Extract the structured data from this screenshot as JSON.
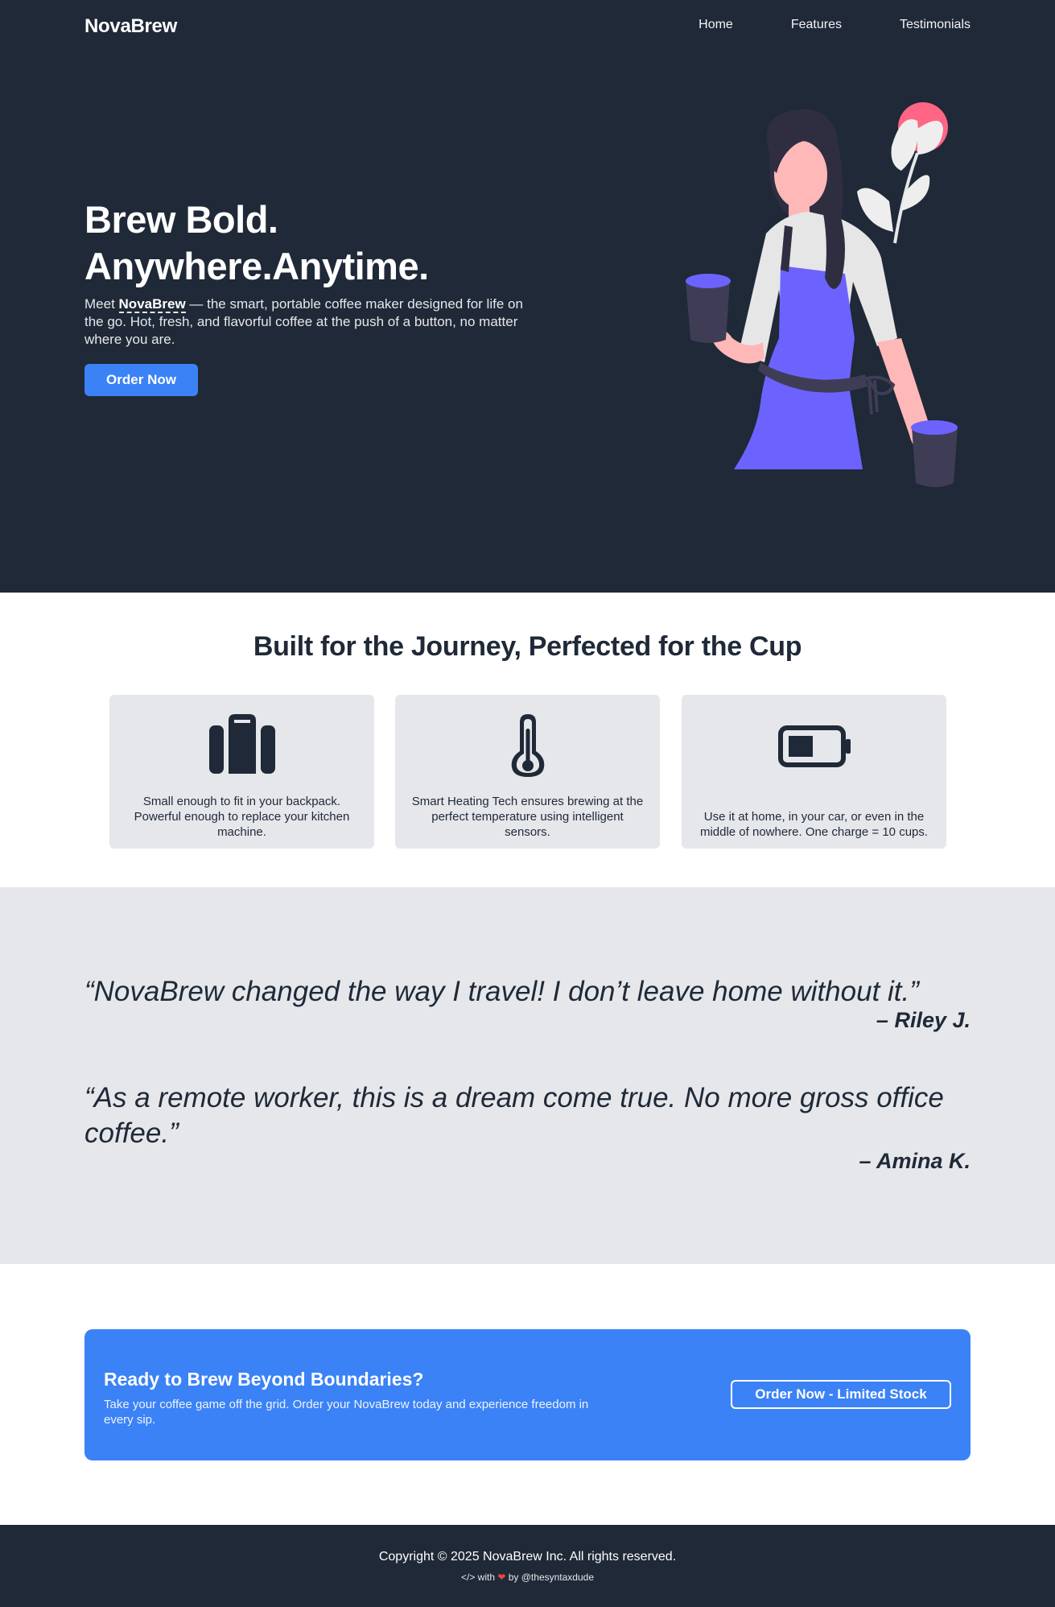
{
  "nav": {
    "brand": "NovaBrew",
    "links": [
      "Home",
      "Features",
      "Testimonials"
    ]
  },
  "hero": {
    "title_line1": "Brew Bold.",
    "title_line2": "Anywhere.Anytime.",
    "desc_prefix": "Meet ",
    "desc_brand": "NovaBrew",
    "desc_suffix": " — the smart, portable coffee maker designed for life on the go. Hot, fresh, and flavorful coffee at the push of a button, no matter where you are.",
    "cta_label": "Order Now"
  },
  "features": {
    "title": "Built for the Journey, Perfected for the Cup",
    "cards": [
      {
        "icon": "suitcase-icon",
        "text": "Small enough to fit in your backpack. Powerful enough to replace your kitchen machine."
      },
      {
        "icon": "thermometer-icon",
        "text": "Smart Heating Tech ensures brewing at the perfect temperature using intelligent sensors."
      },
      {
        "icon": "battery-icon",
        "text": "Use it at home, in your car, or even in the middle of nowhere. One charge = 10 cups."
      }
    ]
  },
  "testimonials": [
    {
      "quote": "“NovaBrew changed the way I travel! I don’t leave home without it.”",
      "author": "– Riley J."
    },
    {
      "quote": "“As a remote worker, this is a dream come true. No more gross office coffee.”",
      "author": "– Amina K."
    }
  ],
  "cta": {
    "title": "Ready to Brew Beyond Boundaries?",
    "text": "Take your coffee game off the grid. Order your NovaBrew today and experience freedom in every sip.",
    "button": "Order Now - Limited Stock"
  },
  "footer": {
    "copyright": "Copyright © 2025 NovaBrew Inc. All rights reserved.",
    "credit_prefix": "</> with ",
    "credit_suffix": " by @thesyntaxdude"
  },
  "colors": {
    "dark": "#1f2937",
    "accent": "#3b82f6",
    "light_gray": "#e5e7eb",
    "illustration_purple": "#6c63ff",
    "illustration_pink": "#ff6584"
  }
}
